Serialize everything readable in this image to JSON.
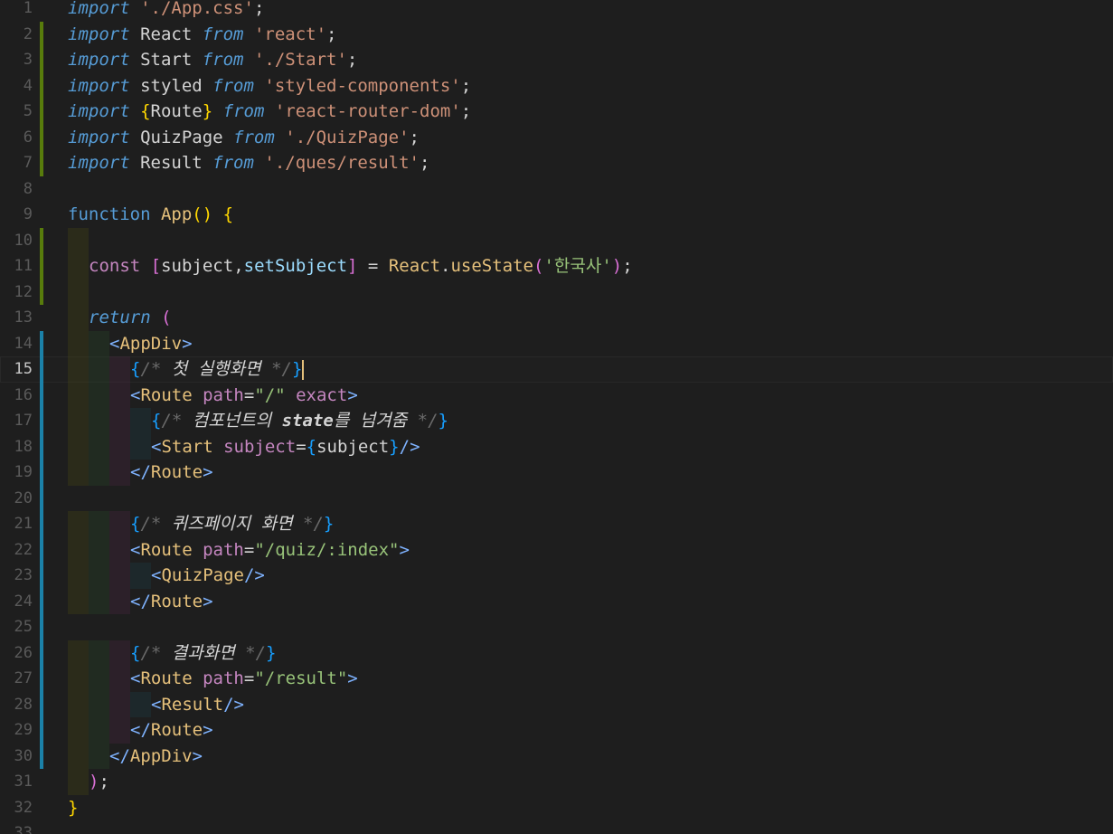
{
  "editor": {
    "language": "javascript",
    "cursor_line": 15,
    "lines": [
      {
        "n": "1",
        "parts": [
          [
            "kw-italic",
            "import"
          ],
          [
            "op",
            " "
          ],
          [
            "str",
            "'./App.css'"
          ],
          [
            "op",
            ";"
          ]
        ]
      },
      {
        "n": "2",
        "parts": [
          [
            "kw-italic",
            "import"
          ],
          [
            "ident",
            " React "
          ],
          [
            "from",
            "from"
          ],
          [
            "op",
            " "
          ],
          [
            "str",
            "'react'"
          ],
          [
            "op",
            ";"
          ]
        ]
      },
      {
        "n": "3",
        "parts": [
          [
            "kw-italic",
            "import"
          ],
          [
            "ident",
            " Start "
          ],
          [
            "from",
            "from"
          ],
          [
            "op",
            " "
          ],
          [
            "str",
            "'./Start'"
          ],
          [
            "op",
            ";"
          ]
        ]
      },
      {
        "n": "4",
        "parts": [
          [
            "kw-italic",
            "import"
          ],
          [
            "ident",
            " styled "
          ],
          [
            "from",
            "from"
          ],
          [
            "op",
            " "
          ],
          [
            "str",
            "'styled-components'"
          ],
          [
            "op",
            ";"
          ]
        ]
      },
      {
        "n": "5",
        "parts": [
          [
            "kw-italic",
            "import"
          ],
          [
            "op",
            " "
          ],
          [
            "brace-y",
            "{"
          ],
          [
            "ident",
            "Route"
          ],
          [
            "brace-y",
            "}"
          ],
          [
            "op",
            " "
          ],
          [
            "from",
            "from"
          ],
          [
            "op",
            " "
          ],
          [
            "str",
            "'react-router-dom'"
          ],
          [
            "op",
            ";"
          ]
        ]
      },
      {
        "n": "6",
        "parts": [
          [
            "kw-italic",
            "import"
          ],
          [
            "ident",
            " QuizPage "
          ],
          [
            "from",
            "from"
          ],
          [
            "op",
            " "
          ],
          [
            "str",
            "'./QuizPage'"
          ],
          [
            "op",
            ";"
          ]
        ]
      },
      {
        "n": "7",
        "parts": [
          [
            "kw-italic",
            "import"
          ],
          [
            "ident",
            " Result "
          ],
          [
            "from",
            "from"
          ],
          [
            "op",
            " "
          ],
          [
            "str",
            "'./ques/result'"
          ],
          [
            "op",
            ";"
          ]
        ]
      },
      {
        "n": "8",
        "parts": []
      },
      {
        "n": "9",
        "parts": [
          [
            "kw",
            "function"
          ],
          [
            "op",
            " "
          ],
          [
            "fn",
            "App"
          ],
          [
            "brace-y",
            "()"
          ],
          [
            "op",
            " "
          ],
          [
            "brace-y",
            "{"
          ]
        ]
      },
      {
        "n": "10",
        "parts": []
      },
      {
        "n": "11",
        "parts": [
          [
            "const",
            "const"
          ],
          [
            "op",
            " "
          ],
          [
            "brace-p",
            "["
          ],
          [
            "ident",
            "subject"
          ],
          [
            "op",
            ","
          ],
          [
            "setter",
            "setSubject"
          ],
          [
            "brace-p",
            "]"
          ],
          [
            "op",
            " = "
          ],
          [
            "fn",
            "React"
          ],
          [
            "op",
            "."
          ],
          [
            "fn",
            "useState"
          ],
          [
            "brace-p",
            "("
          ],
          [
            "str-green",
            "'한국사'"
          ],
          [
            "brace-p",
            ")"
          ],
          [
            "op",
            ";"
          ]
        ]
      },
      {
        "n": "12",
        "parts": []
      },
      {
        "n": "13",
        "parts": [
          [
            "kw-italic",
            "return"
          ],
          [
            "op",
            " "
          ],
          [
            "brace-p",
            "("
          ]
        ]
      },
      {
        "n": "14",
        "parts": [
          [
            "punc",
            "<"
          ],
          [
            "tag",
            "AppDiv"
          ],
          [
            "punc",
            ">"
          ]
        ]
      },
      {
        "n": "15",
        "parts": [
          [
            "brace-b",
            "{"
          ],
          [
            "comment",
            "/* "
          ],
          [
            "comment-ko",
            "첫 실행화면"
          ],
          [
            "comment",
            " */"
          ],
          [
            "brace-b",
            "}"
          ]
        ]
      },
      {
        "n": "16",
        "parts": [
          [
            "punc",
            "<"
          ],
          [
            "tag",
            "Route"
          ],
          [
            "op",
            " "
          ],
          [
            "attr",
            "path"
          ],
          [
            "op",
            "="
          ],
          [
            "str-green",
            "\"/\""
          ],
          [
            "op",
            " "
          ],
          [
            "attr",
            "exact"
          ],
          [
            "punc",
            ">"
          ]
        ]
      },
      {
        "n": "17",
        "parts": [
          [
            "brace-b",
            "{"
          ],
          [
            "comment",
            "/* "
          ],
          [
            "comment-ko",
            "컴포넌트의 "
          ],
          [
            "state-bold",
            "state"
          ],
          [
            "comment-ko",
            "를 넘겨줌"
          ],
          [
            "comment",
            " */"
          ],
          [
            "brace-b",
            "}"
          ]
        ]
      },
      {
        "n": "18",
        "parts": [
          [
            "punc",
            "<"
          ],
          [
            "tag",
            "Start"
          ],
          [
            "op",
            " "
          ],
          [
            "attr",
            "subject"
          ],
          [
            "op",
            "="
          ],
          [
            "brace-b",
            "{"
          ],
          [
            "ident",
            "subject"
          ],
          [
            "brace-b",
            "}"
          ],
          [
            "punc",
            "/>"
          ]
        ]
      },
      {
        "n": "19",
        "parts": [
          [
            "punc",
            "</"
          ],
          [
            "tag",
            "Route"
          ],
          [
            "punc",
            ">"
          ]
        ]
      },
      {
        "n": "20",
        "parts": []
      },
      {
        "n": "21",
        "parts": [
          [
            "brace-b",
            "{"
          ],
          [
            "comment",
            "/* "
          ],
          [
            "comment-ko",
            "퀴즈페이지 화면"
          ],
          [
            "comment",
            " */"
          ],
          [
            "brace-b",
            "}"
          ]
        ]
      },
      {
        "n": "22",
        "parts": [
          [
            "punc",
            "<"
          ],
          [
            "tag",
            "Route"
          ],
          [
            "op",
            " "
          ],
          [
            "attr",
            "path"
          ],
          [
            "op",
            "="
          ],
          [
            "str-green",
            "\"/quiz/:index\""
          ],
          [
            "punc",
            ">"
          ]
        ]
      },
      {
        "n": "23",
        "parts": [
          [
            "punc",
            "<"
          ],
          [
            "tag",
            "QuizPage"
          ],
          [
            "punc",
            "/>"
          ]
        ]
      },
      {
        "n": "24",
        "parts": [
          [
            "punc",
            "</"
          ],
          [
            "tag",
            "Route"
          ],
          [
            "punc",
            ">"
          ]
        ]
      },
      {
        "n": "25",
        "parts": []
      },
      {
        "n": "26",
        "parts": [
          [
            "brace-b",
            "{"
          ],
          [
            "comment",
            "/* "
          ],
          [
            "comment-ko",
            "결과화면"
          ],
          [
            "comment",
            " */"
          ],
          [
            "brace-b",
            "}"
          ]
        ]
      },
      {
        "n": "27",
        "parts": [
          [
            "punc",
            "<"
          ],
          [
            "tag",
            "Route"
          ],
          [
            "op",
            " "
          ],
          [
            "attr",
            "path"
          ],
          [
            "op",
            "="
          ],
          [
            "str-green",
            "\"/result\""
          ],
          [
            "punc",
            ">"
          ]
        ]
      },
      {
        "n": "28",
        "parts": [
          [
            "punc",
            "<"
          ],
          [
            "tag",
            "Result"
          ],
          [
            "punc",
            "/>"
          ]
        ]
      },
      {
        "n": "29",
        "parts": [
          [
            "punc",
            "</"
          ],
          [
            "tag",
            "Route"
          ],
          [
            "punc",
            ">"
          ]
        ]
      },
      {
        "n": "30",
        "parts": [
          [
            "punc",
            "</"
          ],
          [
            "tag",
            "AppDiv"
          ],
          [
            "punc",
            ">"
          ]
        ]
      },
      {
        "n": "31",
        "parts": [
          [
            "brace-p",
            ")"
          ],
          [
            "op",
            ";"
          ]
        ]
      },
      {
        "n": "32",
        "parts": [
          [
            "brace-y",
            "}"
          ]
        ]
      },
      {
        "n": "33",
        "parts": []
      }
    ]
  }
}
